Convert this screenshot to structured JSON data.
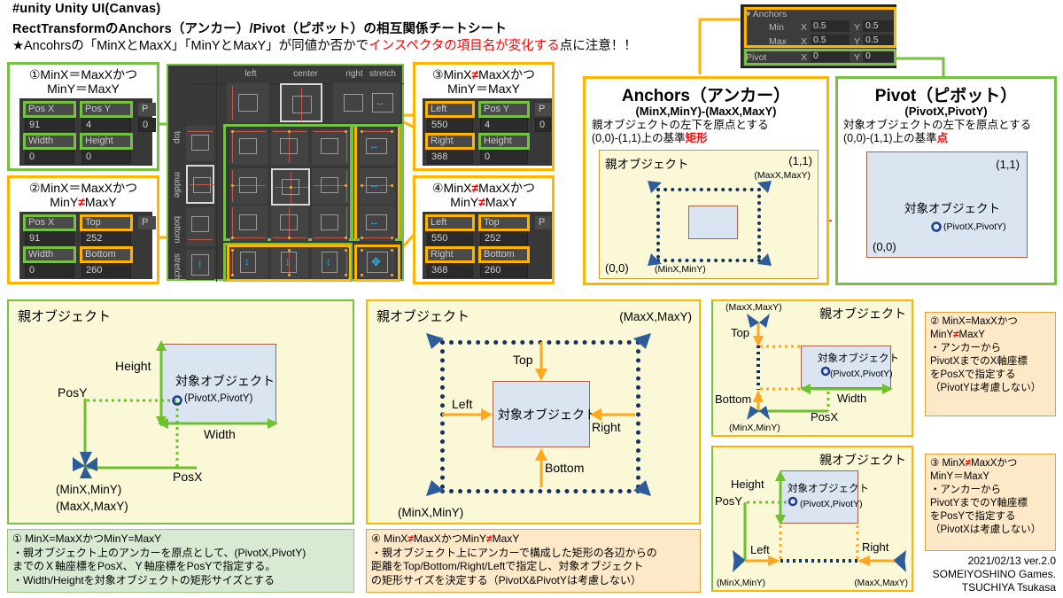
{
  "header": {
    "line1": "#unity   Unity UI(Canvas)",
    "line2": "RectTransformのAnchors（アンカー）/Pivot（ピボット）の相互関係チートシート",
    "line3_a": "★Ancohrsの「MinXとMaxX」「MinYとMaxY」が同値か否かで",
    "line3_red": "インスペクタの項目名が変化する",
    "line3_b": "点に注意！！"
  },
  "cases": {
    "c1": {
      "title": "①MinX＝MaxXかつ\nMinY＝MaxY",
      "fields": [
        {
          "label": "Pos X",
          "value": "91",
          "hl": "green"
        },
        {
          "label": "Pos Y",
          "value": "4",
          "hl": "green"
        },
        {
          "label": "Width",
          "value": "0",
          "hl": "green"
        },
        {
          "label": "Height",
          "value": "0",
          "hl": "green"
        }
      ]
    },
    "c2": {
      "title_a": "②MinX＝MaxXかつ\n MinY",
      "title_ne": "≠",
      "title_b": "MaxY",
      "fields": [
        {
          "label": "Pos X",
          "value": "91",
          "hl": "green"
        },
        {
          "label": "Top",
          "value": "252",
          "hl": "orange"
        },
        {
          "label": "Width",
          "value": "0",
          "hl": "green"
        },
        {
          "label": "Bottom",
          "value": "260",
          "hl": "orange"
        }
      ]
    },
    "c3": {
      "title_a": "③MinX",
      "title_ne": "≠",
      "title_b": "MaxXかつ\n MinY＝MaxY",
      "fields": [
        {
          "label": "Left",
          "value": "550",
          "hl": "orange"
        },
        {
          "label": "Pos Y",
          "value": "4",
          "hl": "green"
        },
        {
          "label": "Right",
          "value": "368",
          "hl": "orange"
        },
        {
          "label": "Height",
          "value": "0",
          "hl": "green"
        }
      ]
    },
    "c4": {
      "title_a": "④MinX",
      "title_ne": "≠",
      "title_b": "MaxXかつ\n MinY",
      "title_ne2": "≠",
      "title_c": "MaxY",
      "fields": [
        {
          "label": "Left",
          "value": "550",
          "hl": "orange"
        },
        {
          "label": "Top",
          "value": "252",
          "hl": "orange"
        },
        {
          "label": "Right",
          "value": "368",
          "hl": "orange"
        },
        {
          "label": "Bottom",
          "value": "260",
          "hl": "orange"
        }
      ]
    }
  },
  "preset_grid": {
    "col_headers": [
      "left",
      "center",
      "right",
      "stretch"
    ],
    "row_headers": [
      "top",
      "middle",
      "bottom",
      "stretch"
    ]
  },
  "inspector": {
    "anchors_label": "Anchors",
    "rows": [
      {
        "name": "Min",
        "x_label": "X",
        "x": "0.5",
        "y_label": "Y",
        "y": "0.5"
      },
      {
        "name": "Max",
        "x_label": "X",
        "x": "0.5",
        "y_label": "Y",
        "y": "0.5"
      }
    ],
    "pivot": {
      "name": "Pivot",
      "x_label": "X",
      "x": "0",
      "y_label": "Y",
      "y": "0"
    }
  },
  "anchors_box": {
    "title": "Anchors（アンカー）",
    "subtitle": "(MinX,MinY)-(MaxX,MaxY)",
    "desc_a": "親オブジェクトの左下を原点とする",
    "desc_b": "(0,0)-(1,1)上の基準",
    "desc_red": "矩形",
    "parent_label": "親オブジェクト",
    "corner_max": "(1,1)",
    "corner_min": "(0,0)",
    "anchor_max": "(MaxX,MaxY)",
    "anchor_min": "(MinX,MinY)"
  },
  "pivot_box": {
    "title": "Pivot（ピボット）",
    "subtitle": "(PivotX,PivotY)",
    "desc_a": "対象オブジェクトの左下を原点とする",
    "desc_b": "(0,0)-(1,1)上の基準",
    "desc_red": "点",
    "object_label": "対象オブジェクト",
    "corner_max": "(1,1)",
    "corner_min": "(0,0)",
    "pivot_label": "(PivotX,PivotY)"
  },
  "diagram1": {
    "parent": "親オブジェクト",
    "object": "対象オブジェクト",
    "height": "Height",
    "width": "Width",
    "posx": "PosX",
    "posy": "PosY",
    "pivot": "(PivotX,PivotY)",
    "anchor_min": "(MinX,MinY)",
    "anchor_max": "(MaxX,MaxY)"
  },
  "diagram4": {
    "parent": "親オブジェクト",
    "object": "対象オブジェクト",
    "top": "Top",
    "bottom": "Bottom",
    "left": "Left",
    "right": "Right",
    "anchor_min": "(MinX,MinY)",
    "anchor_max": "(MaxX,MaxY)"
  },
  "diagram2": {
    "parent": "親オブジェクト",
    "object": "対象オブジェクト",
    "top": "Top",
    "bottom": "Bottom",
    "width": "Width",
    "posx": "PosX",
    "pivot": "(PivotX,PivotY)",
    "anchor_min": "(MinX,MinY)",
    "anchor_max": "(MaxX,MaxY)"
  },
  "diagram3": {
    "parent": "親オブジェクト",
    "object": "対象オブジェクト",
    "height": "Height",
    "posy": "PosY",
    "left": "Left",
    "right": "Right",
    "pivot": "(PivotX,PivotY)",
    "anchor_min": "(MinX,MinY)",
    "anchor_max": "(MaxX,MaxY)"
  },
  "captions": {
    "c1": "① MinX=MaxXかつMinY=MaxY\n・親オブジェクト上のアンカーを原点として、(PivotX,PivotY)\nまでのＸ軸座標をPosX、Ｙ軸座標をPosYで指定する。\n・Width/Heightを対象オブジェクトの矩形サイズとする",
    "c4_a": "④ MinX",
    "c4_ne1": "≠",
    "c4_b": "MaxXかつMinY",
    "c4_ne2": "≠",
    "c4_c": "MaxY\n・親オブジェクト上にアンカーで構成した矩形の各辺からの\n距離をTop/Bottom/Right/Leftで指定し、対象オブジェクト\nの矩形サイズを決定する（PivotX&PivotYは考慮しない）",
    "c2_a": "② MinX=MaxXかつ\nMinY",
    "c2_ne": "≠",
    "c2_b": "MaxY\n・アンカーから\nPivotXまでのX軸座標\nをPosXで指定する\n（PivotYは考慮しない）",
    "c3_a": "③ MinX",
    "c3_ne": "≠",
    "c3_b": "MaxXかつ\nMinY＝MaxY\n・アンカーから\nPivotYまでのY軸座標\nをPosYで指定する\n（PivotXは考慮しない）"
  },
  "credits": "2021/02/13 ver.2.0\nSOMEIYOSHINO Games.\nTSUCHIYA Tsukasa",
  "colors": {
    "green": "#76c043",
    "orange": "#ffb400",
    "red": "#ff0000",
    "unity_bg": "#383838",
    "obj_fill": "#dbe5f2",
    "diagram_bg": "#fbf8d8",
    "anchor_blue": "#2e4a86"
  }
}
